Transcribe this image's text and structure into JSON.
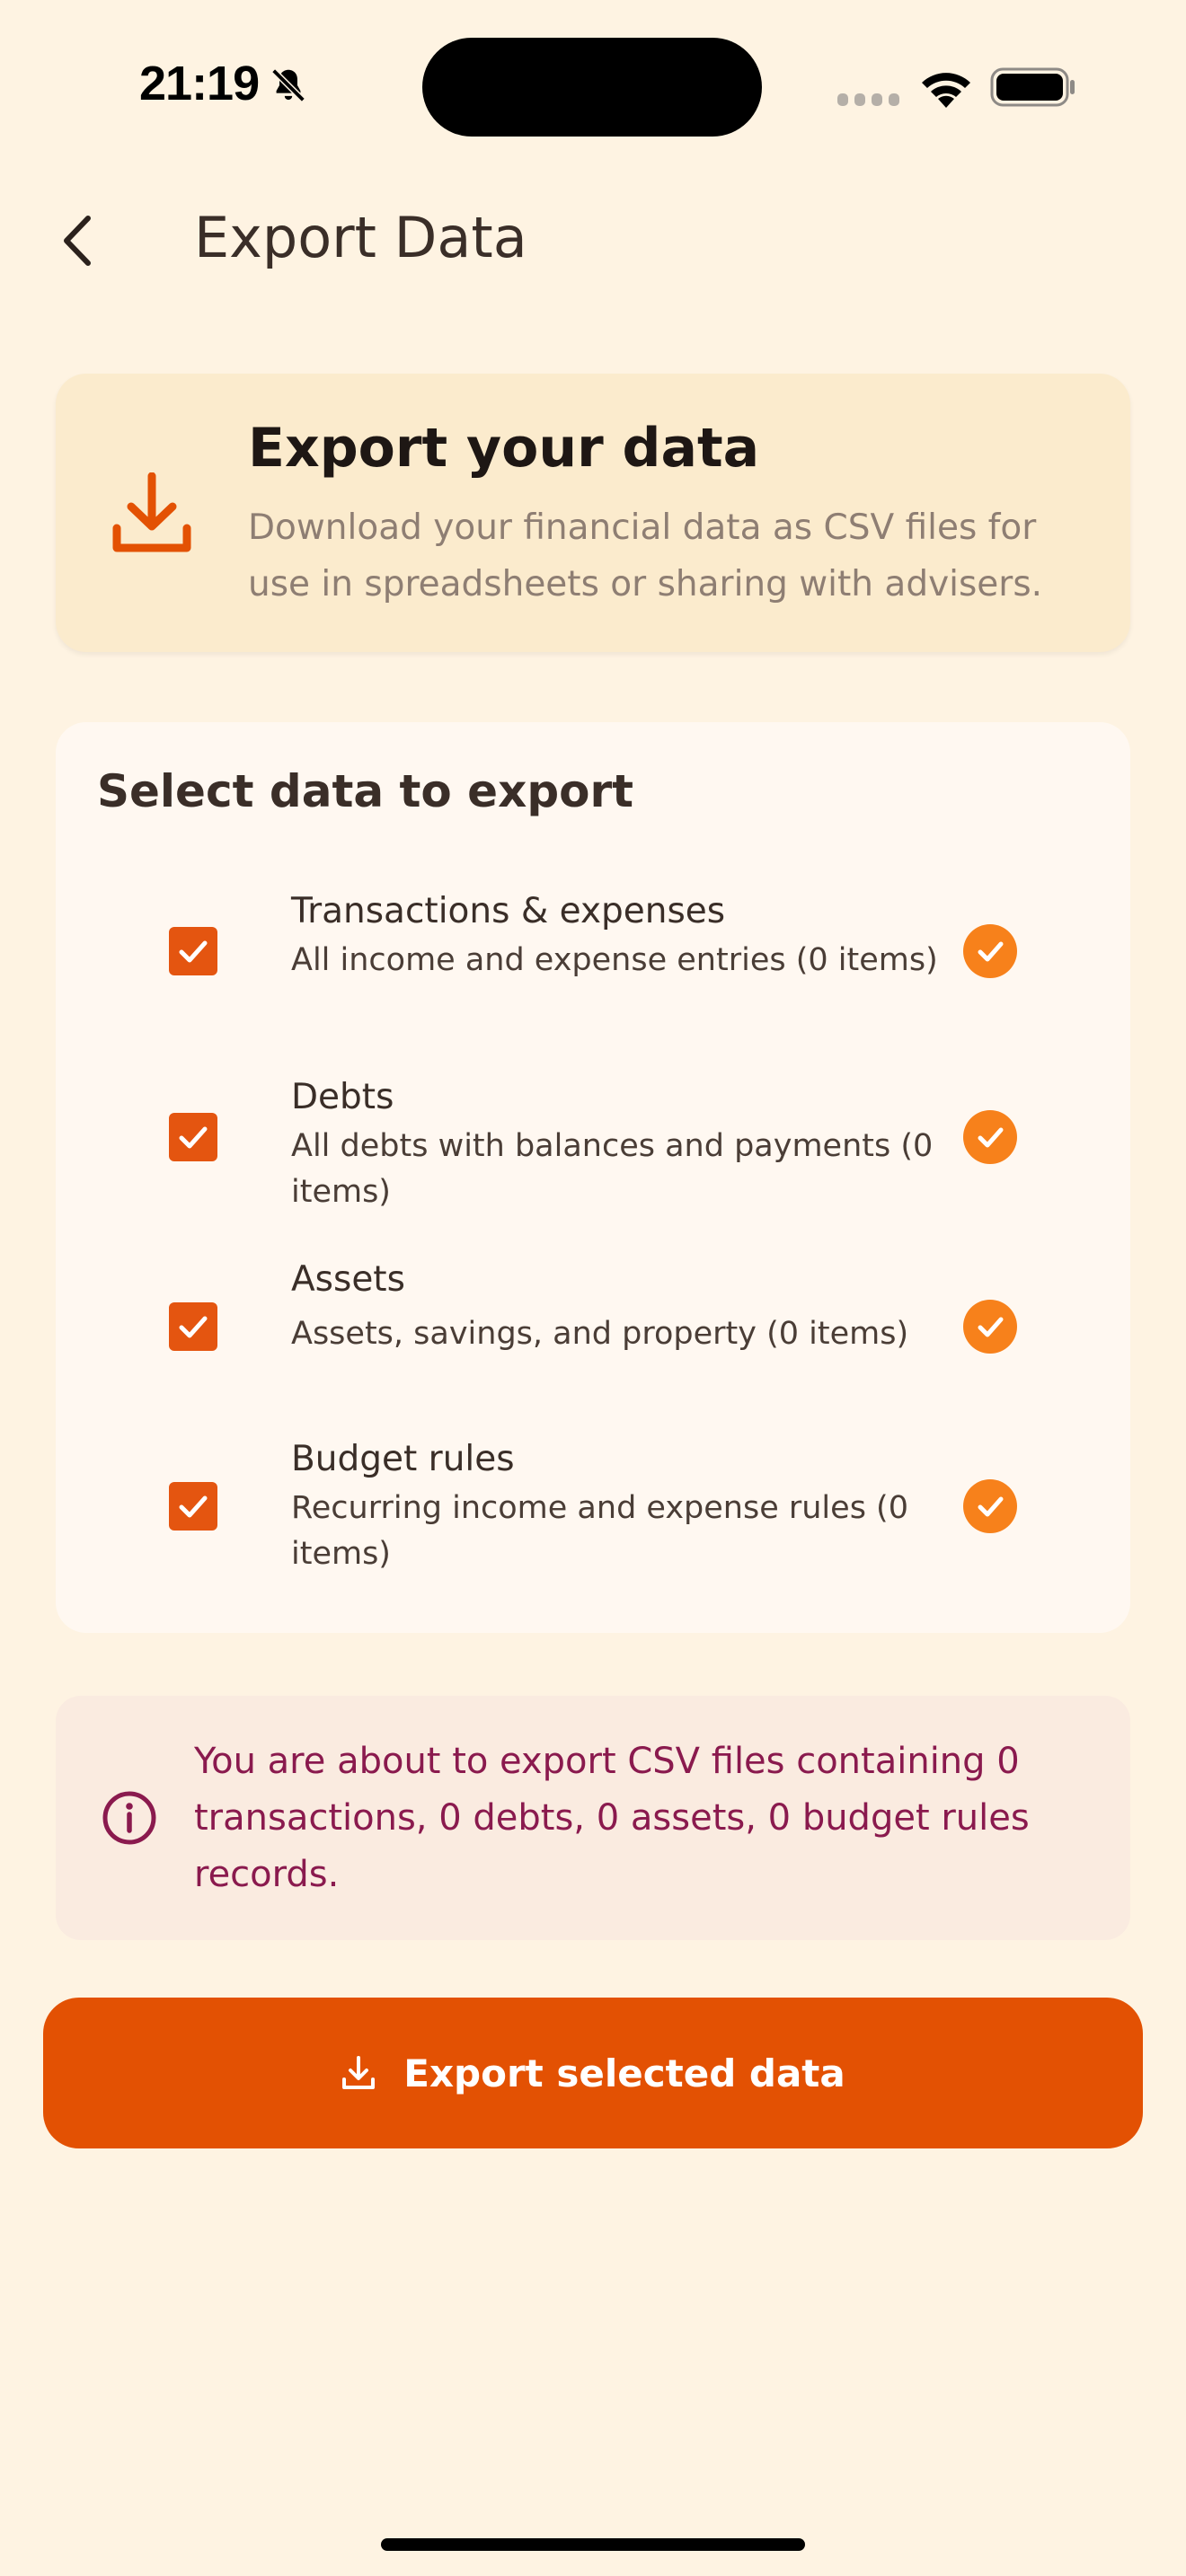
{
  "status_bar": {
    "time": "21:19"
  },
  "header": {
    "title": "Export Data"
  },
  "info_card": {
    "title": "Export your data",
    "description": "Download your financial data as CSV files for use in spreadsheets or sharing with advisers."
  },
  "selection": {
    "heading": "Select data to export",
    "options": [
      {
        "title": "Transactions & expenses",
        "description": "All income and expense entries (0 items)",
        "checked": true
      },
      {
        "title": "Debts",
        "description": "All debts with balances and payments (0 items)",
        "checked": true
      },
      {
        "title": "Assets",
        "description": "Assets, savings, and property (0 items)",
        "checked": true
      },
      {
        "title": "Budget rules",
        "description": "Recurring income and expense rules (0 items)",
        "checked": true
      }
    ]
  },
  "notice": {
    "text": "You are about to export CSV files containing 0 transactions, 0 debts, 0 assets, 0 budget rules records."
  },
  "export_button": {
    "label": "Export selected data"
  },
  "colors": {
    "background": "#FEF3E2",
    "accent": "#E35103",
    "check_orange": "#F7811B",
    "notice_text": "#8A1A4E"
  }
}
